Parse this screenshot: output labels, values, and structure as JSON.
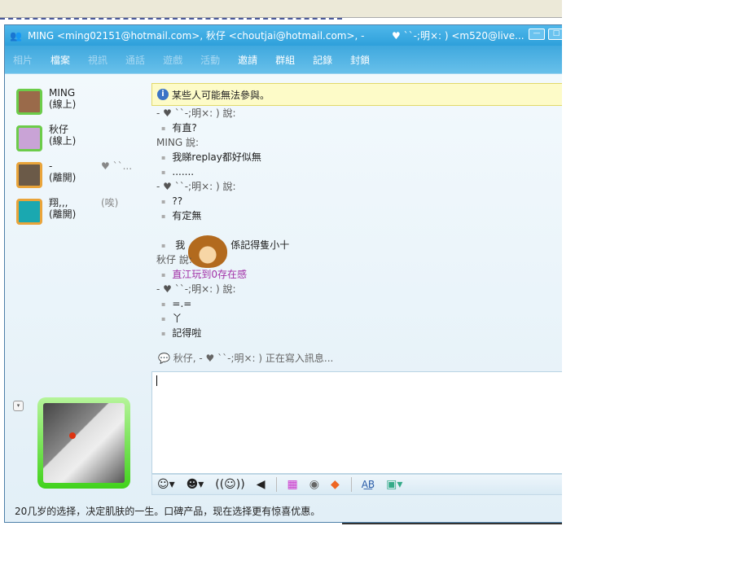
{
  "window": {
    "title_left": "MING <ming02151@hotmail.com>, 秋仔 <choutjai@hotmail.com>, -",
    "title_right": "♥ ``-;明×: ) <m520@live...",
    "minimize": "—",
    "maximize": "□"
  },
  "menu": [
    {
      "label": "相片",
      "enabled": false
    },
    {
      "label": "檔案",
      "enabled": true
    },
    {
      "label": "視訊",
      "enabled": false
    },
    {
      "label": "通話",
      "enabled": false
    },
    {
      "label": "遊戲",
      "enabled": false
    },
    {
      "label": "活動",
      "enabled": false
    },
    {
      "label": "邀請",
      "enabled": true
    },
    {
      "label": "群組",
      "enabled": true
    },
    {
      "label": "記錄",
      "enabled": true
    },
    {
      "label": "封鎖",
      "enabled": true
    }
  ],
  "contacts": [
    {
      "name": "MING",
      "status": "(線上)",
      "extra": ""
    },
    {
      "name": "秋仔",
      "status": "(線上)",
      "extra": ""
    },
    {
      "name": "-",
      "status": "(離開)",
      "extra": "♥ ``..."
    },
    {
      "name": "翔,,,",
      "status": "(離開)",
      "extra": "(唉)"
    }
  ],
  "notice": "某些人可能無法參與。",
  "messages": [
    {
      "t": "s",
      "text": "-              ♥ ``-;明×: ) 說:"
    },
    {
      "t": "m",
      "text": "有直?"
    },
    {
      "t": "s",
      "text": "MING 說:"
    },
    {
      "t": "m",
      "text": "我睇replay都好似無"
    },
    {
      "t": "m",
      "text": "......."
    },
    {
      "t": "s",
      "text": "-              ♥ ``-;明×:  )  說:"
    },
    {
      "t": "m",
      "text": "??"
    },
    {
      "t": "m",
      "text": "有定無"
    }
  ],
  "emoticon_msg": {
    "before": "我",
    "after": "係記得隻小十"
  },
  "messages2": [
    {
      "t": "s",
      "text": "秋仔  說:"
    },
    {
      "t": "m",
      "text": "直江玩到0存在感",
      "purple": true
    },
    {
      "t": "s",
      "text": "-              ♥ ``-;明×: ) 說:"
    },
    {
      "t": "m",
      "text": "=.="
    },
    {
      "t": "m",
      "text": "丫"
    },
    {
      "t": "m",
      "text": "記得啦"
    }
  ],
  "typing": "秋仔, -              ♥ ``-;明×: ) 正在寫入訊息...",
  "toolbar": {
    "emoticon": "☺▾",
    "wink": "☻▾",
    "nudge": "((☺))",
    "voice_clip": "◀",
    "background": "▦",
    "sound": "◉",
    "games": "◆",
    "font": "A͟B",
    "share": "▣▾"
  },
  "ad": "20几岁的选择，决定肌肤的一生。口碑产品，现在选择更有惊喜优惠。"
}
